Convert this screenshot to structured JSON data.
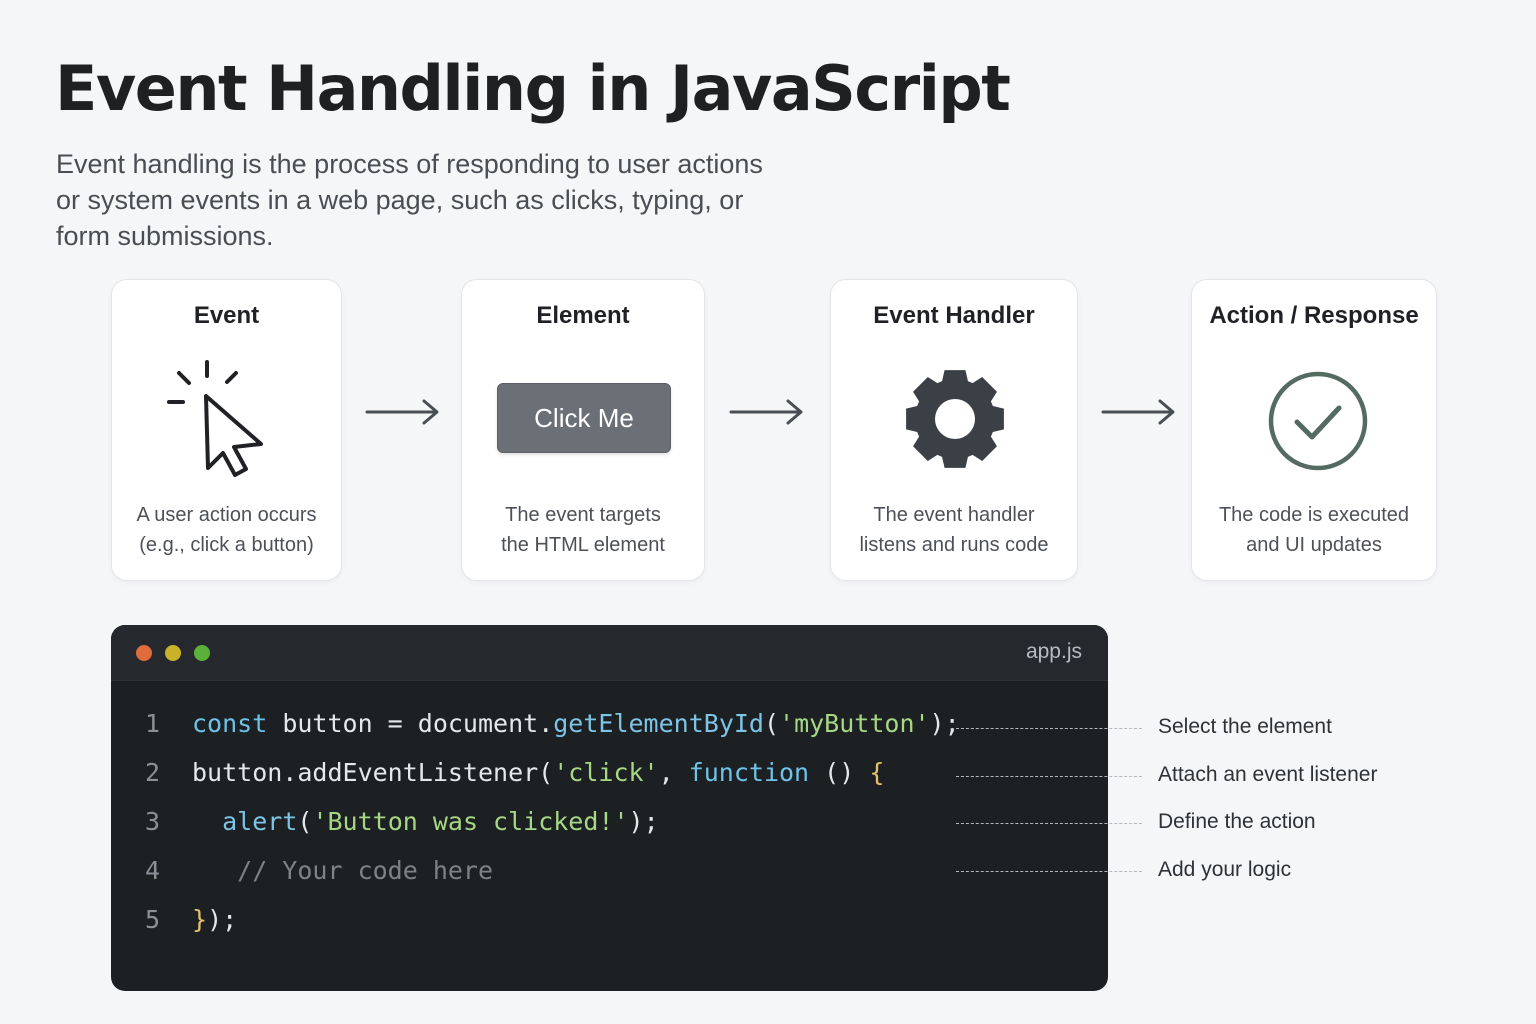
{
  "header": {
    "title": "Event Handling in JavaScript",
    "subtitle_lines": [
      "Event handling is the process of responding to user actions",
      "or system events in a web page, such as clicks, typing, or",
      "form submissions."
    ]
  },
  "steps": [
    {
      "title": "Event",
      "icon": "cursor-click-icon",
      "desc": [
        "A user action occurs",
        "(e.g., click a button)"
      ]
    },
    {
      "title": "Element",
      "icon": "button",
      "button_label": "Click Me",
      "desc": [
        "The event targets",
        "the HTML element"
      ]
    },
    {
      "title": "Event Handler",
      "icon": "gear-icon",
      "desc": [
        "The event handler",
        "listens and runs code"
      ]
    },
    {
      "title": "Action / Response",
      "icon": "check-circle-icon",
      "desc": [
        "The code is executed",
        "and UI updates"
      ]
    }
  ],
  "editor": {
    "filename": "app.js",
    "dot_colors": [
      "#e06c3c",
      "#c9b22a",
      "#5bb03a"
    ],
    "lines": [
      {
        "n": "1",
        "tokens": [
          {
            "t": "const",
            "c": "kw"
          },
          {
            "t": " button = document."
          },
          {
            "t": "getElementById",
            "c": "fn"
          },
          {
            "t": "("
          },
          {
            "t": "'myButton'",
            "c": "str"
          },
          {
            "t": ");"
          }
        ]
      },
      {
        "n": "2",
        "tokens": [
          {
            "t": "button.addEventListener("
          },
          {
            "t": "'click'",
            "c": "str"
          },
          {
            "t": ", "
          },
          {
            "t": "function",
            "c": "kw"
          },
          {
            "t": " () "
          },
          {
            "t": "{",
            "c": "brace"
          }
        ]
      },
      {
        "n": "3",
        "tokens": [
          {
            "t": "  "
          },
          {
            "t": "alert",
            "c": "fn"
          },
          {
            "t": "("
          },
          {
            "t": "'Button was clicked!'",
            "c": "str"
          },
          {
            "t": ");"
          }
        ]
      },
      {
        "n": "4",
        "tokens": [
          {
            "t": "   // Your code here",
            "c": "cmt"
          }
        ]
      },
      {
        "n": "5",
        "tokens": [
          {
            "t": "}",
            "c": "brace"
          },
          {
            "t": ");"
          }
        ]
      }
    ]
  },
  "annotations": [
    "Select the element",
    "Attach an event listener",
    "Define the action",
    "Add your logic"
  ]
}
